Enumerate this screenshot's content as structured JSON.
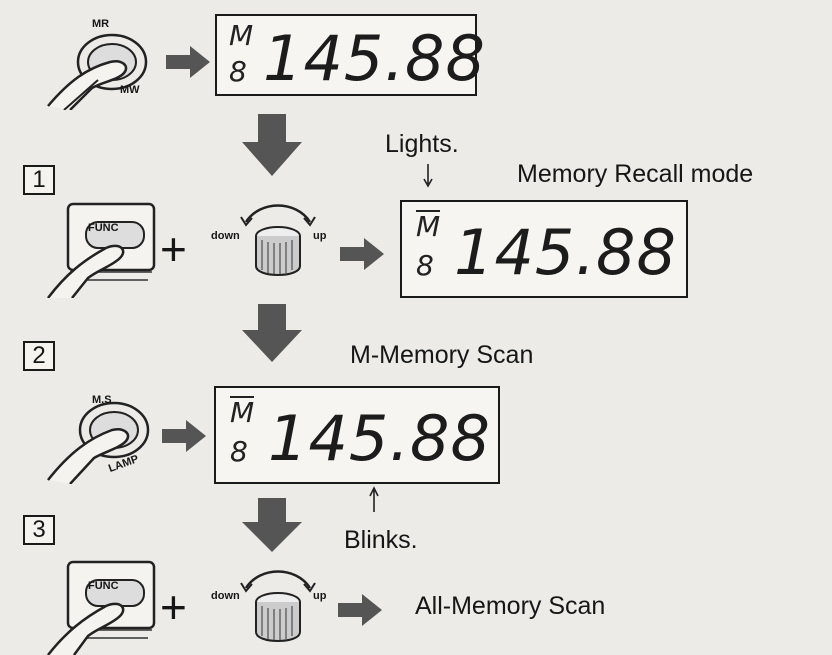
{
  "top_display": {
    "mem_letter": "M",
    "channel_digit": "8",
    "frequency": "145.88"
  },
  "top_button": {
    "label_top": "MR",
    "label_bottom": "MW"
  },
  "step1": {
    "number": "1",
    "button_label": "FUNC",
    "dial_down": "down",
    "dial_up": "up",
    "annotation_lights": "Lights.",
    "mode_label": "Memory Recall mode",
    "display": {
      "mem_letter": "M",
      "channel_digit": "8",
      "frequency": "145.88"
    }
  },
  "step2": {
    "number": "2",
    "title": "M-Memory Scan",
    "button_label_top": "M.S",
    "button_label_bottom": "LAMP",
    "display": {
      "mem_letter": "M",
      "channel_digit": "8",
      "frequency": "145.88"
    },
    "annotation_blinks": "Blinks."
  },
  "step3": {
    "number": "3",
    "button_label": "FUNC",
    "dial_down": "down",
    "dial_up": "up",
    "result_label": "All-Memory Scan"
  },
  "colors": {
    "arrow": "#555555",
    "ink": "#161616",
    "paper": "#ecebe8"
  }
}
